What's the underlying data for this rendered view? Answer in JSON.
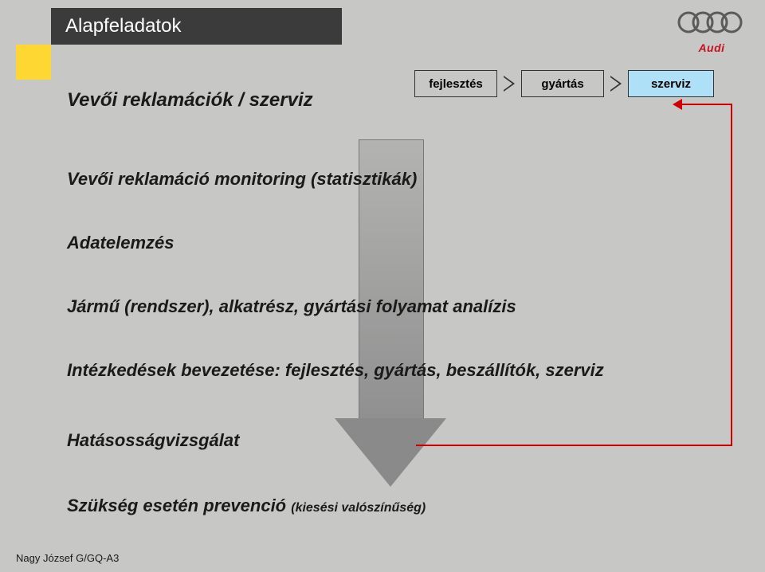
{
  "header": {
    "title": "Alapfeladatok",
    "brand": "Audi"
  },
  "subtitle": "Vevői reklamációk / szerviz",
  "phases": {
    "dev": "fejlesztés",
    "mfg": "gyártás",
    "serv": "szerviz"
  },
  "lines": {
    "monitor": "Vevői reklamáció monitoring (statisztikák)",
    "adat": "Adatelemzés",
    "jarmu": "Jármű (rendszer), alkatrész, gyártási folyamat analízis",
    "intez": "Intézkedések bevezetése: fejlesztés, gyártás, beszállítók, szerviz",
    "hatas": "Hatásosságvizsgálat",
    "prev_main": "Szükség esetén prevenció ",
    "prev_small": "(kiesési valószínűség)"
  },
  "footer": "Nagy József G/GQ-A3"
}
